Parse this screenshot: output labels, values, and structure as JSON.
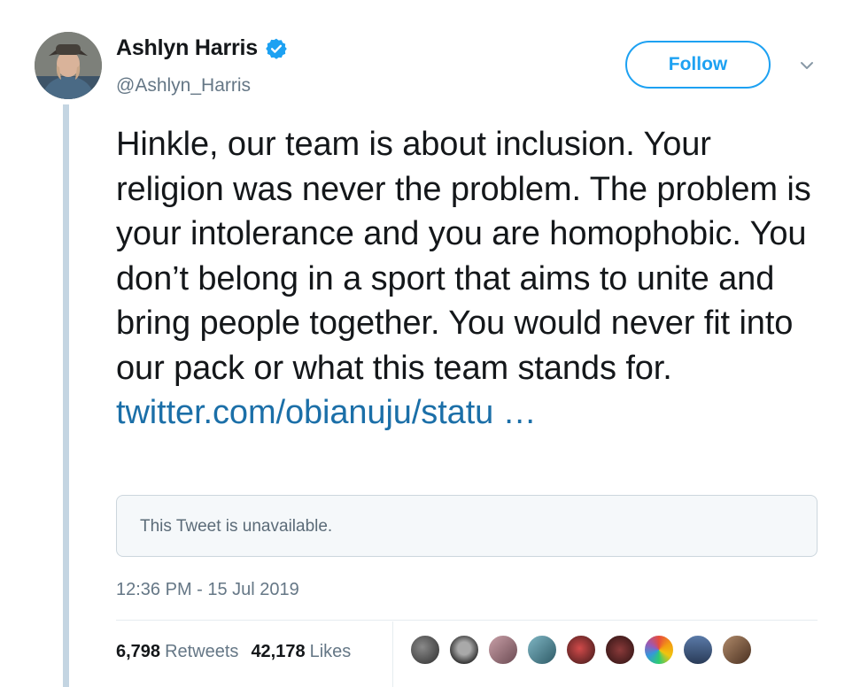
{
  "tweet": {
    "author": {
      "display_name": "Ashlyn Harris",
      "handle": "@Ashlyn_Harris",
      "verified": true,
      "avatar_icon": "profile-photo"
    },
    "follow_label": "Follow",
    "text": "Hinkle, our team is about inclusion. Your religion was never the problem. The problem is your intolerance and you are homophobic. You don’t belong in a sport that aims to unite and bring people together. You would never fit into our pack or what this team stands for.",
    "link_text": "twitter.com/obianuju/statu …",
    "quoted_tweet": {
      "text": "This Tweet is unavailable."
    },
    "timestamp": "12:36 PM - 15 Jul 2019",
    "stats": {
      "retweets_count": "6,798",
      "retweets_label": "Retweets",
      "likes_count": "42,178",
      "likes_label": "Likes"
    },
    "liked_by_avatar_count": 9
  },
  "colors": {
    "accent": "#1da1f2",
    "link": "#1b6fa8",
    "secondary_text": "#657786",
    "thread_line": "#c4d5e2"
  }
}
